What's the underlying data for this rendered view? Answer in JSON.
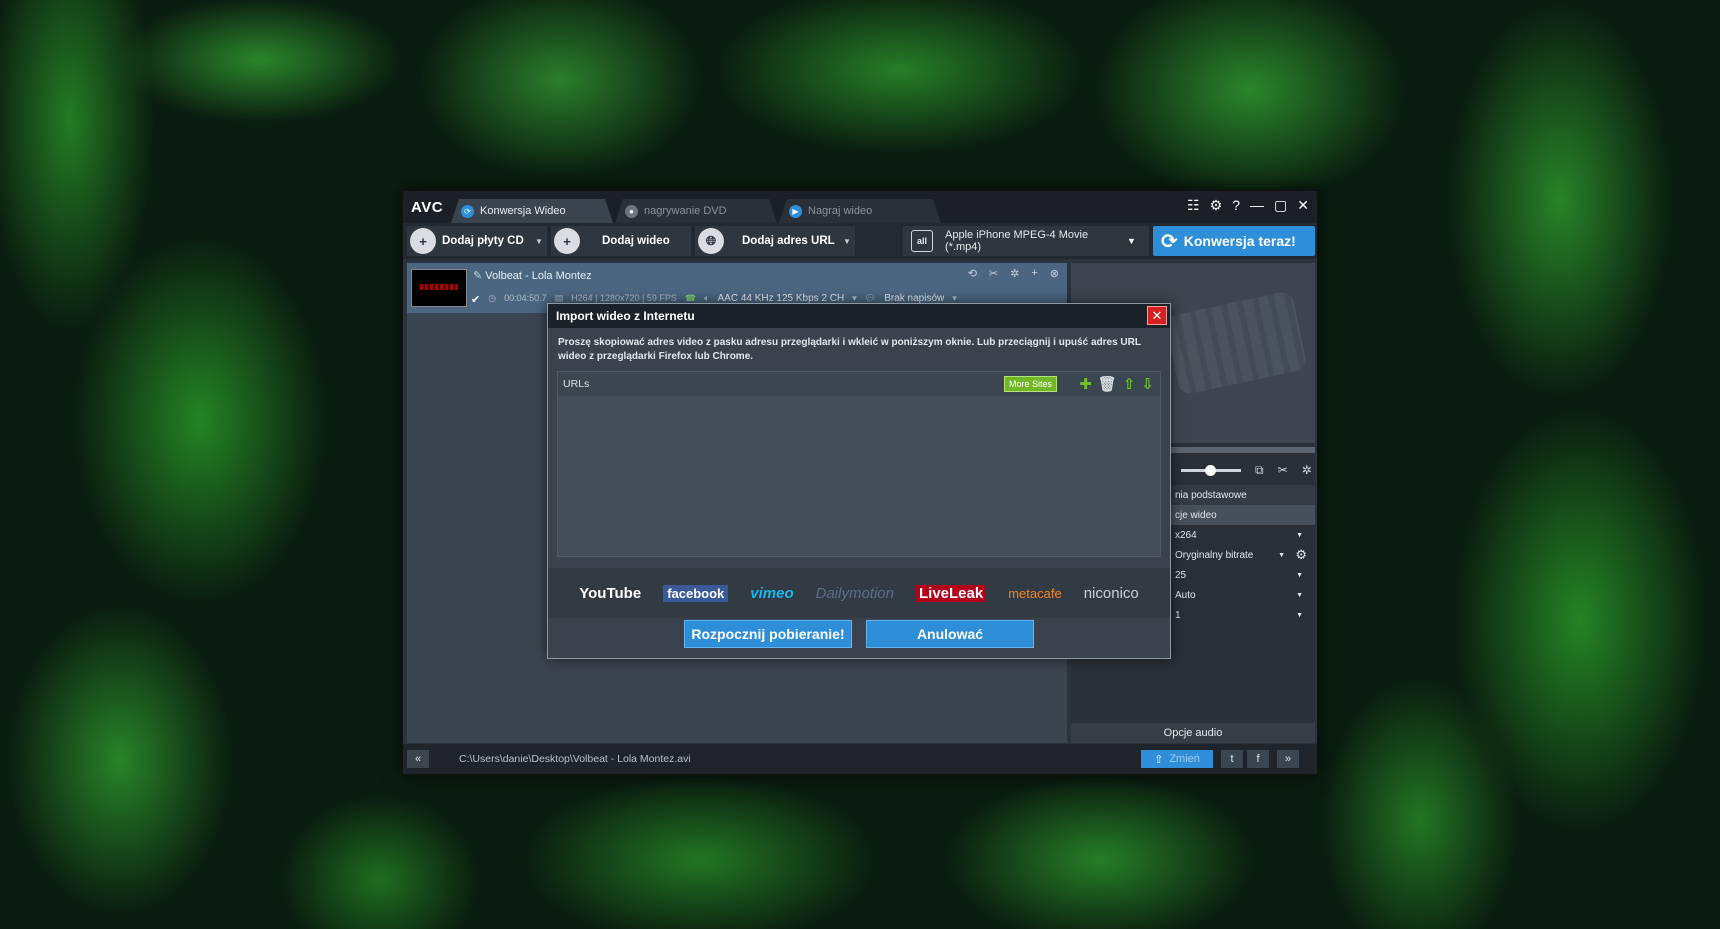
{
  "app": {
    "logo": "AVC",
    "tabs": [
      {
        "label": "Konwersja Wideo",
        "icon": "refresh-icon"
      },
      {
        "label": "nagrywanie DVD",
        "icon": "disc-icon"
      },
      {
        "label": "Nagraj wideo",
        "icon": "play-icon"
      }
    ]
  },
  "toolbar": {
    "add_cd": "Dodaj płyty CD",
    "add_video": "Dodaj wideo",
    "add_url": "Dodaj adres URL",
    "profile": "Apple iPhone MPEG-4 Movie (*.mp4)",
    "profile_icon_text": "all",
    "convert": "Konwersja teraz!"
  },
  "file": {
    "title": "Volbeat - Lola Montez",
    "duration": "00:04:50.7",
    "video_info": "H264 | 1280x720 | 59 FPS",
    "audio_info": "AAC 44 KHz 125 Kbps 2 CH",
    "subtitles": "Brak napisów"
  },
  "right_panel": {
    "section_basic": "nia podstawowe",
    "section_video": "cje wideo",
    "options": [
      {
        "value": "x264"
      },
      {
        "value": "Oryginalny bitrate"
      },
      {
        "value": "25"
      },
      {
        "value": "Auto"
      },
      {
        "value": "1"
      }
    ],
    "audio_options": "Opcje audio"
  },
  "statusbar": {
    "path": "C:\\Users\\danie\\Desktop\\Volbeat - Lola Montez.avi",
    "change": "Zmień",
    "back": "«",
    "forward": "»",
    "twitter": "t",
    "facebook": "f"
  },
  "dialog": {
    "title": "Import wideo z Internetu",
    "close": "✕",
    "message": "Proszę skopiować adres video z pasku adresu przeglądarki i wkleić w poniższym oknie. Lub przeciągnij i upuść adres URL wideo z przeglądarki Firefox lub Chrome.",
    "urls_label": "URLs",
    "more_sites": "More Sites",
    "sites": [
      {
        "label": "YouTube",
        "color": "#e62117"
      },
      {
        "label": "facebook",
        "color": "#3b5998"
      },
      {
        "label": "vimeo",
        "color": "#1ab7ea"
      },
      {
        "label": "Dailymotion",
        "color": "#5a6f87"
      },
      {
        "label": "LiveLeak",
        "color": "#b3001b"
      },
      {
        "label": "metacafe",
        "color": "#f5841f"
      },
      {
        "label": "niconico",
        "color": "#c9d1d9"
      }
    ],
    "start": "Rozpocznij pobieranie!",
    "cancel": "Anulować"
  },
  "colors": {
    "accent": "#2f8ed8",
    "more_sites": "#72b728",
    "close": "#d42020"
  }
}
